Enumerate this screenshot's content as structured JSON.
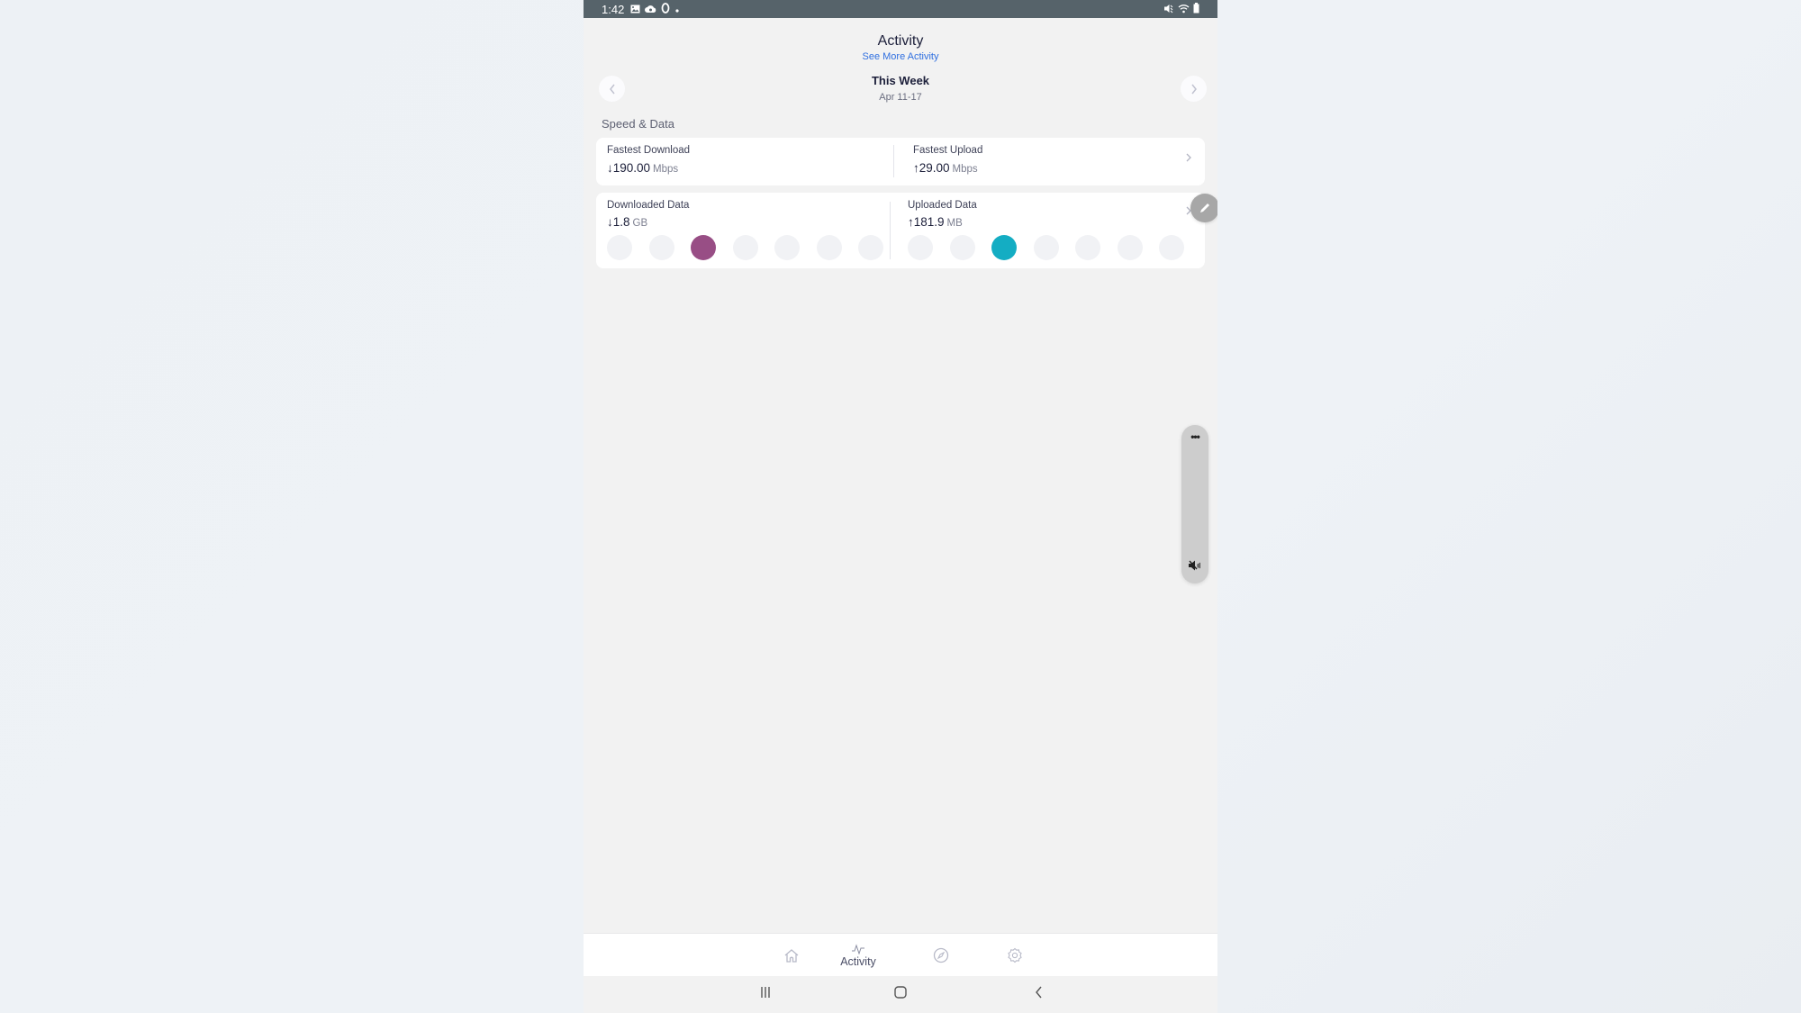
{
  "status_bar": {
    "time": "1:42",
    "left_icons": [
      "gallery-icon",
      "cloud-icon",
      "sync-ring-icon",
      "dot-icon"
    ],
    "right_icons": [
      "mute-icon",
      "wifi-icon",
      "battery-icon"
    ]
  },
  "header": {
    "title": "Activity",
    "link": "See More Activity",
    "link_color": "#2f6fe0"
  },
  "period": {
    "title": "This Week",
    "range": "Apr 11-17",
    "prev_icon": "chevron-left-icon",
    "next_icon": "chevron-right-icon"
  },
  "section": {
    "label": "Speed & Data"
  },
  "speed_card": {
    "download": {
      "label": "Fastest Download",
      "arrow": "↓",
      "value": "190.00",
      "unit": "Mbps"
    },
    "upload": {
      "label": "Fastest Upload",
      "arrow": "↑",
      "value": "29.00",
      "unit": "Mbps"
    }
  },
  "data_card": {
    "download": {
      "label": "Downloaded Data",
      "arrow": "↓",
      "value": "1.8",
      "unit": "GB",
      "active_day_index": 2,
      "day_count": 7,
      "active_color": "#984e85"
    },
    "upload": {
      "label": "Uploaded Data",
      "arrow": "↑",
      "value": "181.9",
      "unit": "MB",
      "active_day_index": 2,
      "day_count": 7,
      "active_color": "#14adc3"
    }
  },
  "floating": {
    "edit_icon": "pencil-icon",
    "panel_more": "•••",
    "panel_mute_icon": "mute-icon"
  },
  "bottom_nav": {
    "tabs": [
      {
        "name": "home",
        "icon": "home-icon",
        "label": ""
      },
      {
        "name": "activity",
        "icon": "activity-pulse-icon",
        "label": "Activity",
        "active": true
      },
      {
        "name": "explore",
        "icon": "compass-icon",
        "label": ""
      },
      {
        "name": "settings",
        "icon": "gear-icon",
        "label": ""
      }
    ]
  },
  "system_nav": {
    "buttons": [
      "recents-icon",
      "home-button-icon",
      "back-icon"
    ]
  }
}
